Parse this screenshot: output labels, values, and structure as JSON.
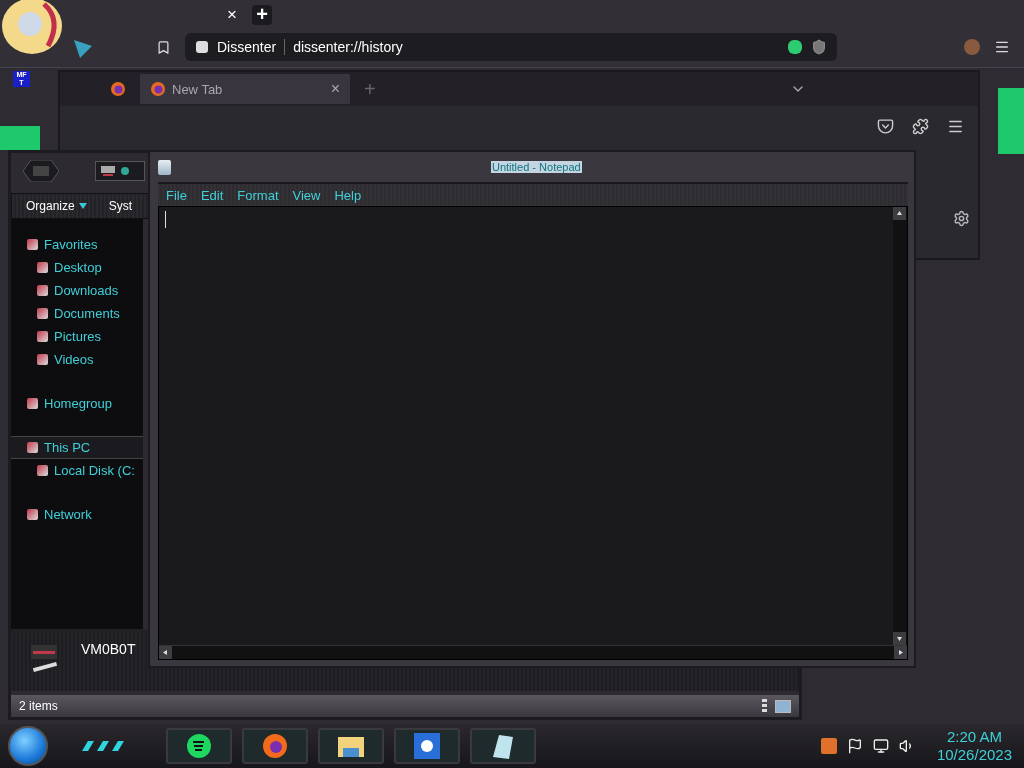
{
  "browser": {
    "tab_close": "×",
    "new_tab": "+",
    "site_name": "Dissenter",
    "url": "dissenter://history"
  },
  "badge": {
    "lines": [
      "MF",
      "T"
    ]
  },
  "firefox": {
    "tabs": [
      {
        "label": "New Tab",
        "selected": true
      }
    ],
    "tab_close": "×",
    "new_tab": "+"
  },
  "explorer": {
    "toolbar": [
      "Organize",
      "Syst"
    ],
    "nav": [
      {
        "label": "Favorites",
        "selected": false,
        "children": [
          {
            "label": "Desktop",
            "selected": false
          },
          {
            "label": "Downloads",
            "selected": false
          },
          {
            "label": "Documents",
            "selected": false
          },
          {
            "label": "Pictures",
            "selected": false
          },
          {
            "label": "Videos",
            "selected": false
          }
        ]
      },
      {
        "label": "Homegroup",
        "selected": false
      },
      {
        "label": "This PC",
        "selected": true,
        "children": [
          {
            "label": "Local Disk (C:",
            "selected": false
          }
        ]
      },
      {
        "label": "Network",
        "selected": false
      }
    ],
    "details": {
      "name": "VM0B0T"
    },
    "status": "2 items"
  },
  "notepad": {
    "title": "Untitled - Notepad",
    "menu": [
      "File",
      "Edit",
      "Format",
      "View",
      "Help"
    ]
  },
  "clock": {
    "time": "2:20 AM",
    "date": "10/26/2023"
  }
}
